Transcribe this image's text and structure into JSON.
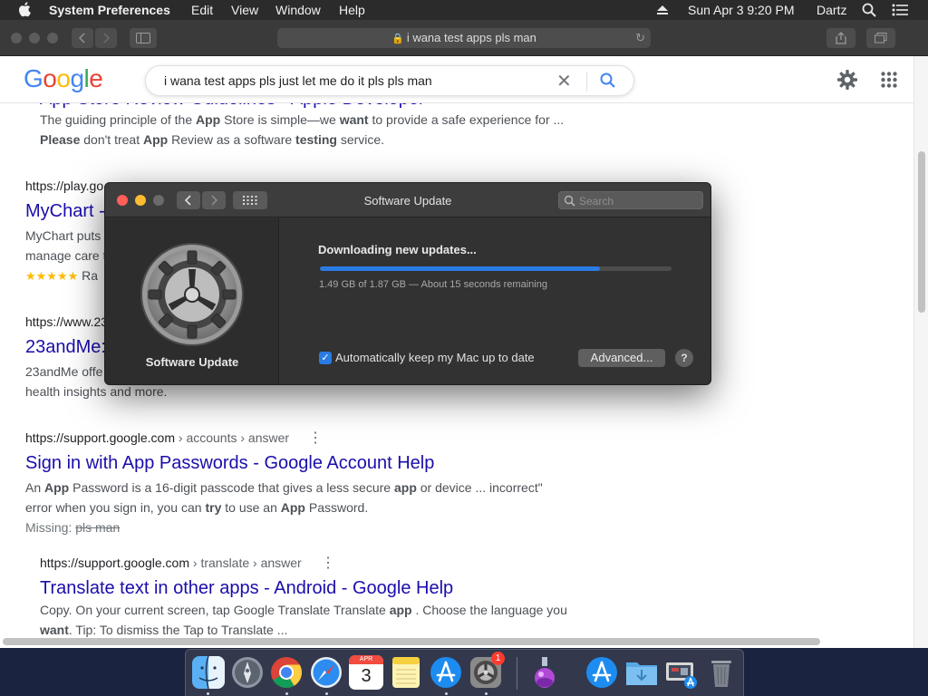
{
  "menubar": {
    "app_name": "System Preferences",
    "items": [
      "Edit",
      "View",
      "Window",
      "Help"
    ],
    "clock": "Sun Apr 3  9:20 PM",
    "user": "Dartz"
  },
  "safari": {
    "address": "i wana test apps pls man"
  },
  "google": {
    "query": "i wana test apps pls just let me do it pls pls man",
    "logo_letters": [
      "G",
      "o",
      "o",
      "g",
      "l",
      "e"
    ],
    "logo_colors": [
      "#4285f4",
      "#ea4335",
      "#fbbc05",
      "#4285f4",
      "#34a853",
      "#ea4335"
    ]
  },
  "results": {
    "r0": {
      "title": "App Store Review Guidelines - Apple Developer",
      "snip1_a": "The guiding principle of the ",
      "snip1_b": "App",
      "snip1_c": " Store is simple—we ",
      "snip1_d": "want",
      "snip1_e": " to provide a safe experience for ...",
      "snip2_a": "Please",
      "snip2_b": " don't treat ",
      "snip2_c": "App",
      "snip2_d": " Review as a software ",
      "snip2_e": "testing",
      "snip2_f": " service."
    },
    "r1": {
      "url": "https://play.go",
      "title": "MyChart -",
      "snip1": "MyChart puts",
      "snip2": "manage care t",
      "stars": "★★★★★",
      "rating": "Ra"
    },
    "r2": {
      "url": "https://www.23",
      "title": "23andMe:",
      "snip1": "23andMe offe",
      "snip2": "health insights and more."
    },
    "r3": {
      "url": "https://support.google.com",
      "crumb": " › accounts › answer",
      "title": "Sign in with App Passwords - Google Account Help",
      "s1a": "An ",
      "s1b": "App",
      "s1c": " Password is a 16-digit passcode that gives a less secure ",
      "s1d": "app",
      "s1e": " or device ... incorrect\"",
      "s2a": "error when you sign in, you can ",
      "s2b": "try",
      "s2c": " to use an ",
      "s2d": "App",
      "s2e": " Password.",
      "missing_label": "Missing: ",
      "missing_terms": "pls man"
    },
    "r4": {
      "url": "https://support.google.com",
      "crumb": " › translate › answer",
      "title": "Translate text in other apps - Android - Google Help",
      "s1a": "Copy. On your current screen, tap Google Translate Translate ",
      "s1b": "app",
      "s1c": " . Choose the language you",
      "s2a": "want",
      "s2b": ". Tip: To dismiss the Tap to Translate ..."
    }
  },
  "software_update": {
    "window_title": "Software Update",
    "search_placeholder": "Search",
    "left_label": "Software Update",
    "status": "Downloading new updates...",
    "progress_fraction": 0.796,
    "progress_text": "1.49 GB of 1.87 GB — About 15 seconds remaining",
    "auto_update_label": "Automatically keep my Mac up to date",
    "auto_update_checked": true,
    "advanced_label": "Advanced...",
    "help_label": "?"
  },
  "dock": {
    "calendar_month": "APR",
    "calendar_day": "3",
    "badge_count": "1",
    "apps": [
      "finder",
      "launchpad",
      "chrome",
      "safari",
      "calendar",
      "notes",
      "app-store",
      "system-preferences",
      "installer",
      "xcode-appstore",
      "downloads-folder",
      "screenshots",
      "trash"
    ]
  },
  "colors": {
    "google_blue": "#4285f4",
    "link": "#1a0dab",
    "progress": "#2a7be4",
    "close": "#ff5f57",
    "minimize": "#febc2e"
  }
}
